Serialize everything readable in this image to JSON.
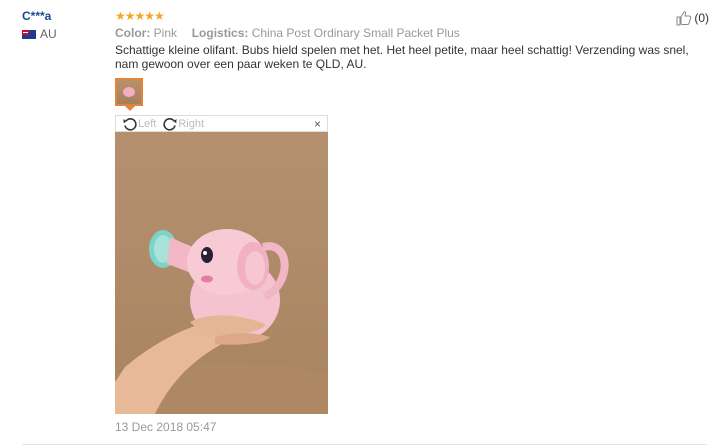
{
  "user": {
    "name": "C***a",
    "country": "AU"
  },
  "review": {
    "stars": "★★★★★",
    "color_label": "Color:",
    "color_value": "Pink",
    "logistics_label": "Logistics:",
    "logistics_value": "China Post Ordinary Small Packet Plus",
    "text": "Schattige kleine olifant. Bubs hield spelen met het. Het heel petite, maar heel schattig! Verzending was snel, nam gewoon over een paar weken te QLD, AU.",
    "date": "13 Dec 2018 05:47",
    "rating": 5
  },
  "helpful": {
    "count": "(0)"
  },
  "viewer": {
    "left_label": "Left",
    "right_label": "Right",
    "close_label": "×"
  },
  "icons": {
    "thumb": "thumbs-up-icon",
    "flag": "flag-au-icon",
    "rotate_left": "rotate-left-icon",
    "rotate_right": "rotate-right-icon"
  },
  "colors": {
    "star": "#f5a623",
    "username": "#1a4a8a",
    "thumb_border": "#e4843a"
  }
}
